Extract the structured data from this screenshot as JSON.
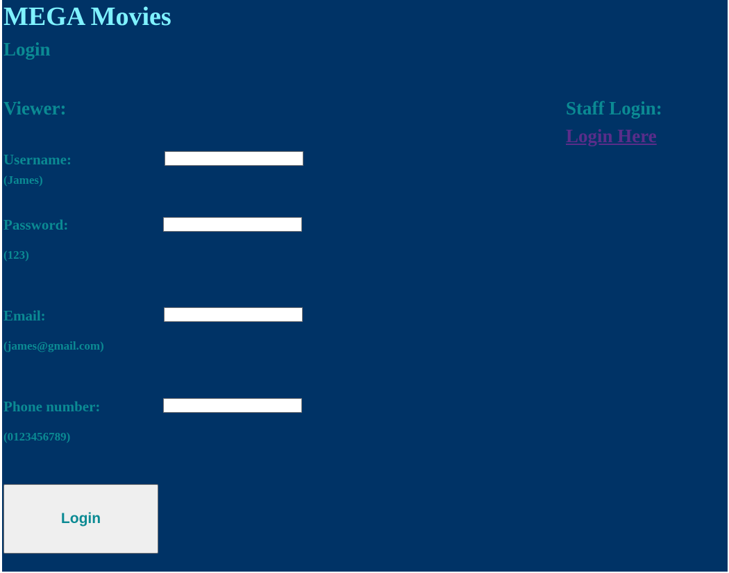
{
  "site": {
    "title": "MEGA Movies"
  },
  "page": {
    "heading": "Login"
  },
  "viewer": {
    "heading": "Viewer:",
    "fields": [
      {
        "label": "Username:",
        "hint": "(James)",
        "value": ""
      },
      {
        "label": "Password:",
        "hint": "(123)",
        "value": ""
      },
      {
        "label": "Email:",
        "hint": "(james@gmail.com)",
        "value": ""
      },
      {
        "label": "Phone number:",
        "hint": "(0123456789)",
        "value": ""
      }
    ],
    "login_button": "Login"
  },
  "staff": {
    "heading": "Staff Login:",
    "link": "Login Here"
  },
  "colors": {
    "background": "#003366",
    "title": "#7ff2ff",
    "text": "#0b8a93",
    "link": "#5a2d8a",
    "button_bg": "#efefef"
  }
}
